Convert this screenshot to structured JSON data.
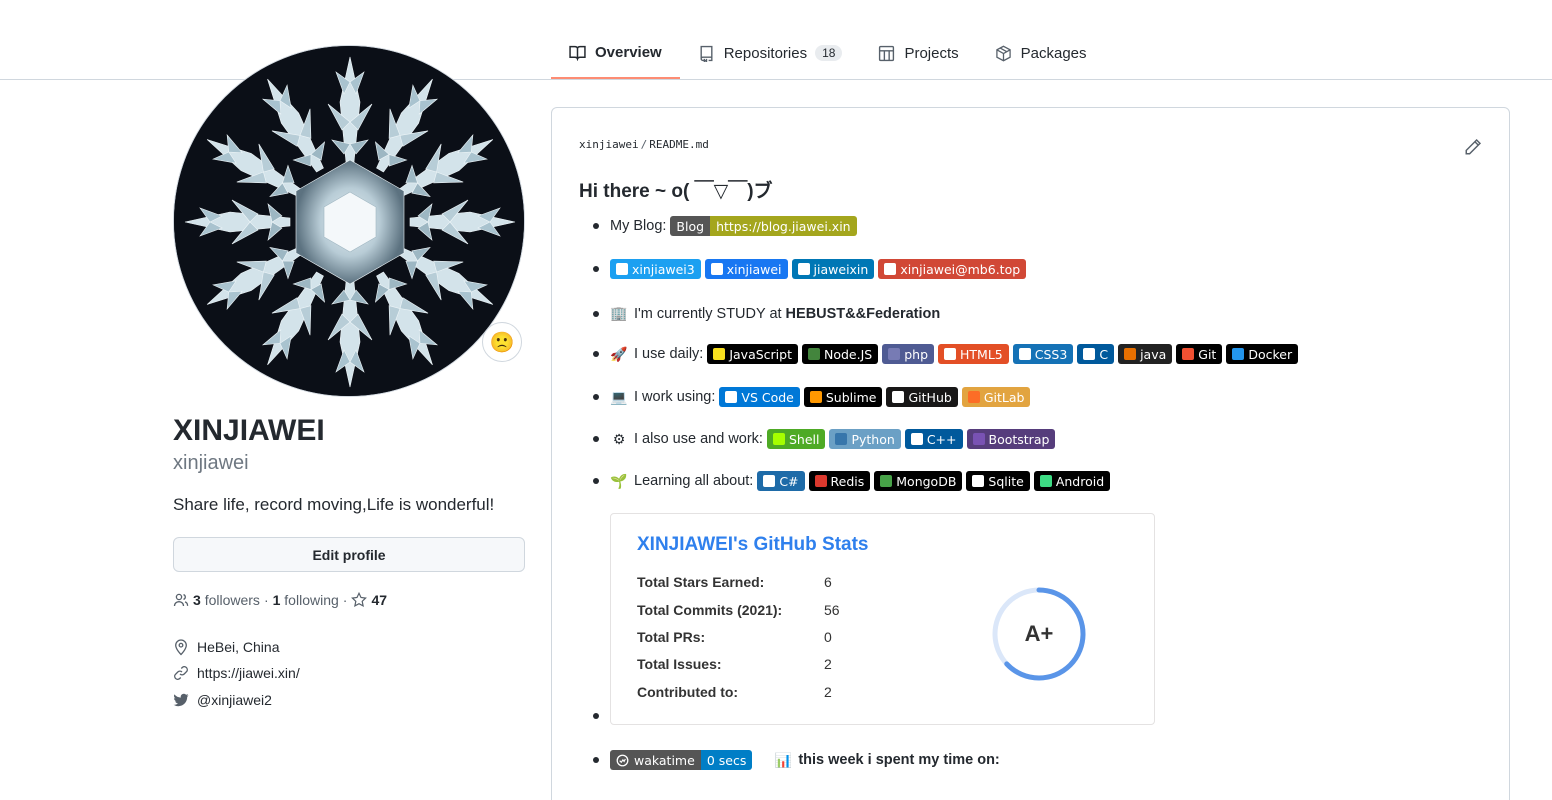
{
  "nav": {
    "tabs": [
      {
        "label": "Overview",
        "icon": "book-icon",
        "selected": true
      },
      {
        "label": "Repositories",
        "icon": "repo-icon",
        "count": "18"
      },
      {
        "label": "Projects",
        "icon": "project-icon"
      },
      {
        "label": "Packages",
        "icon": "package-icon"
      }
    ]
  },
  "profile": {
    "fullname": "XINJIAWEI",
    "login": "xinjiawei",
    "bio": "Share life, record moving,Life is wonderful!",
    "edit_label": "Edit profile",
    "followers_count": "3",
    "followers_label": "followers",
    "following_count": "1",
    "following_label": "following",
    "stars_count": "47",
    "location": "HeBei, China",
    "website": "https://jiawei.xin/",
    "twitter": "@xinjiawei2",
    "status_emoji": "🙁"
  },
  "readme": {
    "owner": "xinjiawei",
    "file": "README.md",
    "heading": "Hi there ~ o( ￣▽￣)ブ",
    "blog_label": "My Blog:",
    "blog_badge_left": "Blog",
    "blog_badge_right": "https://blog.jiawei.xin",
    "social": [
      {
        "label": "xinjiawei3",
        "icon": "twitter-icon",
        "color": "#1ca0f1"
      },
      {
        "label": "xinjiawei",
        "icon": "facebook-icon",
        "color": "#1877f2"
      },
      {
        "label": "jiaweixin",
        "icon": "linkedin-icon",
        "color": "#0077b5"
      },
      {
        "label": "xinjiawei@mb6.top",
        "icon": "gmail-icon",
        "color": "#d14836"
      }
    ],
    "study_text": "I'm currently STUDY at ",
    "study_place": "HEBUST&&Federation",
    "daily_label": "I use daily:",
    "daily": [
      {
        "label": "JavaScript",
        "color": "#000000",
        "icon_color": "#f7df1e"
      },
      {
        "label": "Node.JS",
        "color": "#000000",
        "icon_color": "#43853d"
      },
      {
        "label": "php",
        "color": "#4f5b93",
        "icon_color": "#777bb4"
      },
      {
        "label": "HTML5",
        "color": "#e34f26",
        "icon_color": "#ffffff"
      },
      {
        "label": "CSS3",
        "color": "#1572b6",
        "icon_color": "#ffffff"
      },
      {
        "label": "C",
        "color": "#00599c",
        "icon_color": "#ffffff"
      },
      {
        "label": "java",
        "color": "#222222",
        "icon_color": "#e76f00"
      },
      {
        "label": "Git",
        "color": "#000000",
        "icon_color": "#f05032"
      },
      {
        "label": "Docker",
        "color": "#000000",
        "icon_color": "#2496ed"
      }
    ],
    "work_label": "I work using:",
    "work": [
      {
        "label": "VS Code",
        "color": "#0078d7",
        "icon_color": "#ffffff"
      },
      {
        "label": "Sublime",
        "color": "#000000",
        "icon_color": "#ff9800"
      },
      {
        "label": "GitHub",
        "color": "#181717",
        "icon_color": "#ffffff"
      },
      {
        "label": "GitLab",
        "color": "#e2a440",
        "icon_color": "#fc6d26"
      }
    ],
    "also_label": "I also use and work:",
    "also": [
      {
        "label": "Shell",
        "color": "#4eaa25",
        "icon_color": "#a6ff00"
      },
      {
        "label": "Python",
        "color": "#6ba0c5",
        "icon_color": "#3776ab"
      },
      {
        "label": "C++",
        "color": "#00599c",
        "icon_color": "#ffffff"
      },
      {
        "label": "Bootstrap",
        "color": "#563d7c",
        "icon_color": "#7952b3"
      }
    ],
    "learning_label": "Learning all about:",
    "learning": [
      {
        "label": "C#",
        "color": "#1e6ba8",
        "icon_color": "#ffffff"
      },
      {
        "label": "Redis",
        "color": "#000000",
        "icon_color": "#dc382d"
      },
      {
        "label": "MongoDB",
        "color": "#000000",
        "icon_color": "#47a248"
      },
      {
        "label": "Sqlite",
        "color": "#000000",
        "icon_color": "#ffffff"
      },
      {
        "label": "Android",
        "color": "#000000",
        "icon_color": "#3ddc84"
      }
    ],
    "stats": {
      "title": "XINJIAWEI's GitHub Stats",
      "rows": [
        {
          "label": "Total Stars Earned:",
          "value": "6"
        },
        {
          "label": "Total Commits (2021):",
          "value": "56"
        },
        {
          "label": "Total PRs:",
          "value": "0"
        },
        {
          "label": "Total Issues:",
          "value": "2"
        },
        {
          "label": "Contributed to:",
          "value": "2"
        }
      ],
      "rank": "A+",
      "ring_progress": 0.63,
      "ring_color": "#5a95e8"
    },
    "wakatime_left": "wakatime",
    "wakatime_right": "0 secs",
    "week_text": "this week i spent my time on:"
  }
}
